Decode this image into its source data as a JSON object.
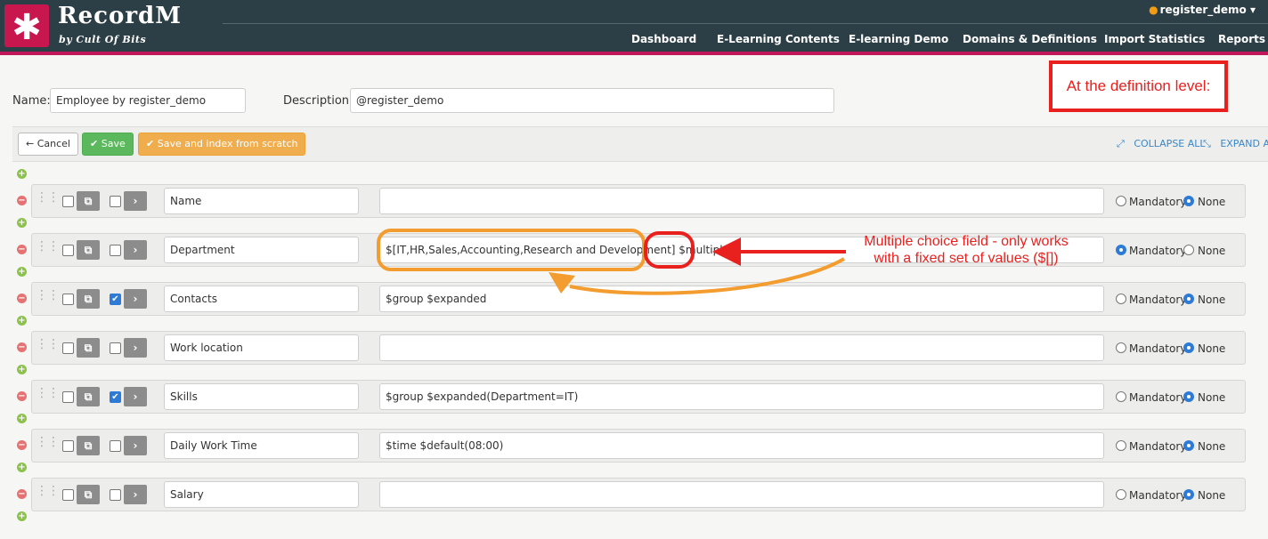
{
  "app": {
    "brand": "RecordM",
    "brand_sub": "by Cult Of Bits",
    "logo_glyph": "✱",
    "user": "register_demo",
    "nav": [
      "Dashboard",
      "E-Learning Contents",
      "E-learning Demo",
      "Domains & Definitions",
      "Import Statistics",
      "Reports"
    ]
  },
  "form": {
    "name_label": "Name:",
    "name_value": "Employee by register_demo",
    "description_label": "Description:",
    "description_value": "@register_demo"
  },
  "toolbar": {
    "cancel": "Cancel",
    "save": "Save",
    "save_reindex": "Save and index from scratch",
    "collapse_all": "COLLAPSE ALL",
    "expand_all": "EXPAND ALL"
  },
  "radio_labels": {
    "mandatory": "Mandatory",
    "none": "None"
  },
  "fields": [
    {
      "name": "Name",
      "description": "",
      "checked": false,
      "mandatory": false
    },
    {
      "name": "Department",
      "description": "$[IT,HR,Sales,Accounting,Research and Development] $multiple",
      "checked": false,
      "mandatory": true
    },
    {
      "name": "Contacts",
      "description": "$group $expanded",
      "checked": true,
      "mandatory": false
    },
    {
      "name": "Work location",
      "description": "",
      "checked": false,
      "mandatory": false
    },
    {
      "name": "Skills",
      "description": "$group $expanded(Department=IT)",
      "checked": true,
      "mandatory": false
    },
    {
      "name": "Daily Work Time",
      "description": "$time $default(08:00)",
      "checked": false,
      "mandatory": false
    },
    {
      "name": "Salary",
      "description": "",
      "checked": false,
      "mandatory": false
    }
  ],
  "annotations": {
    "definition_level": "At the definition level:",
    "callout_line1": "Multiple choice field - only works",
    "callout_line2": "with a fixed set of values ($[])"
  },
  "colors": {
    "header": "#2c3f46",
    "brand": "#c8174f",
    "annotation_red": "#e8201e",
    "annotation_orange": "#f39c2f",
    "accent_blue": "#2d7bd6"
  }
}
